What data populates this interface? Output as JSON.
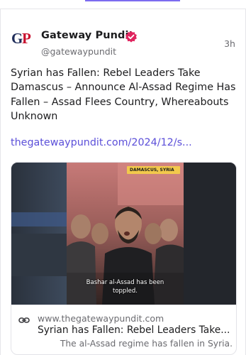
{
  "post": {
    "author_name": "Gateway Pundit",
    "handle": "@gatewaypundit",
    "time": "3h",
    "avatar_text": "GP",
    "text": "Syrian has Fallen: Rebel Leaders Take Damascus – Announce Al-Assad Regime Has Fallen – Assad Flees Country, Whereabouts Unknown",
    "link_text": "thegatewaypundit.com/2024/12/s..."
  },
  "card": {
    "location_tag": "DAMASCUS, SYRIA",
    "caption_line1": "Bashar al-Assad has been",
    "caption_line2": "toppled.",
    "domain": "www.thegatewaypundit.com",
    "title": "Syrian has Fallen: Rebel Leaders Take...",
    "description": "The al-Assad regime has fallen in Syria."
  },
  "icons": {
    "verified": "verified-badge-icon",
    "link": "link-icon"
  },
  "colors": {
    "accent": "#7c6cf0",
    "link": "#5b4fd9",
    "verified_badge": "#e0245e",
    "avatar_red": "#c8102e",
    "avatar_navy": "#1f2d5a"
  }
}
